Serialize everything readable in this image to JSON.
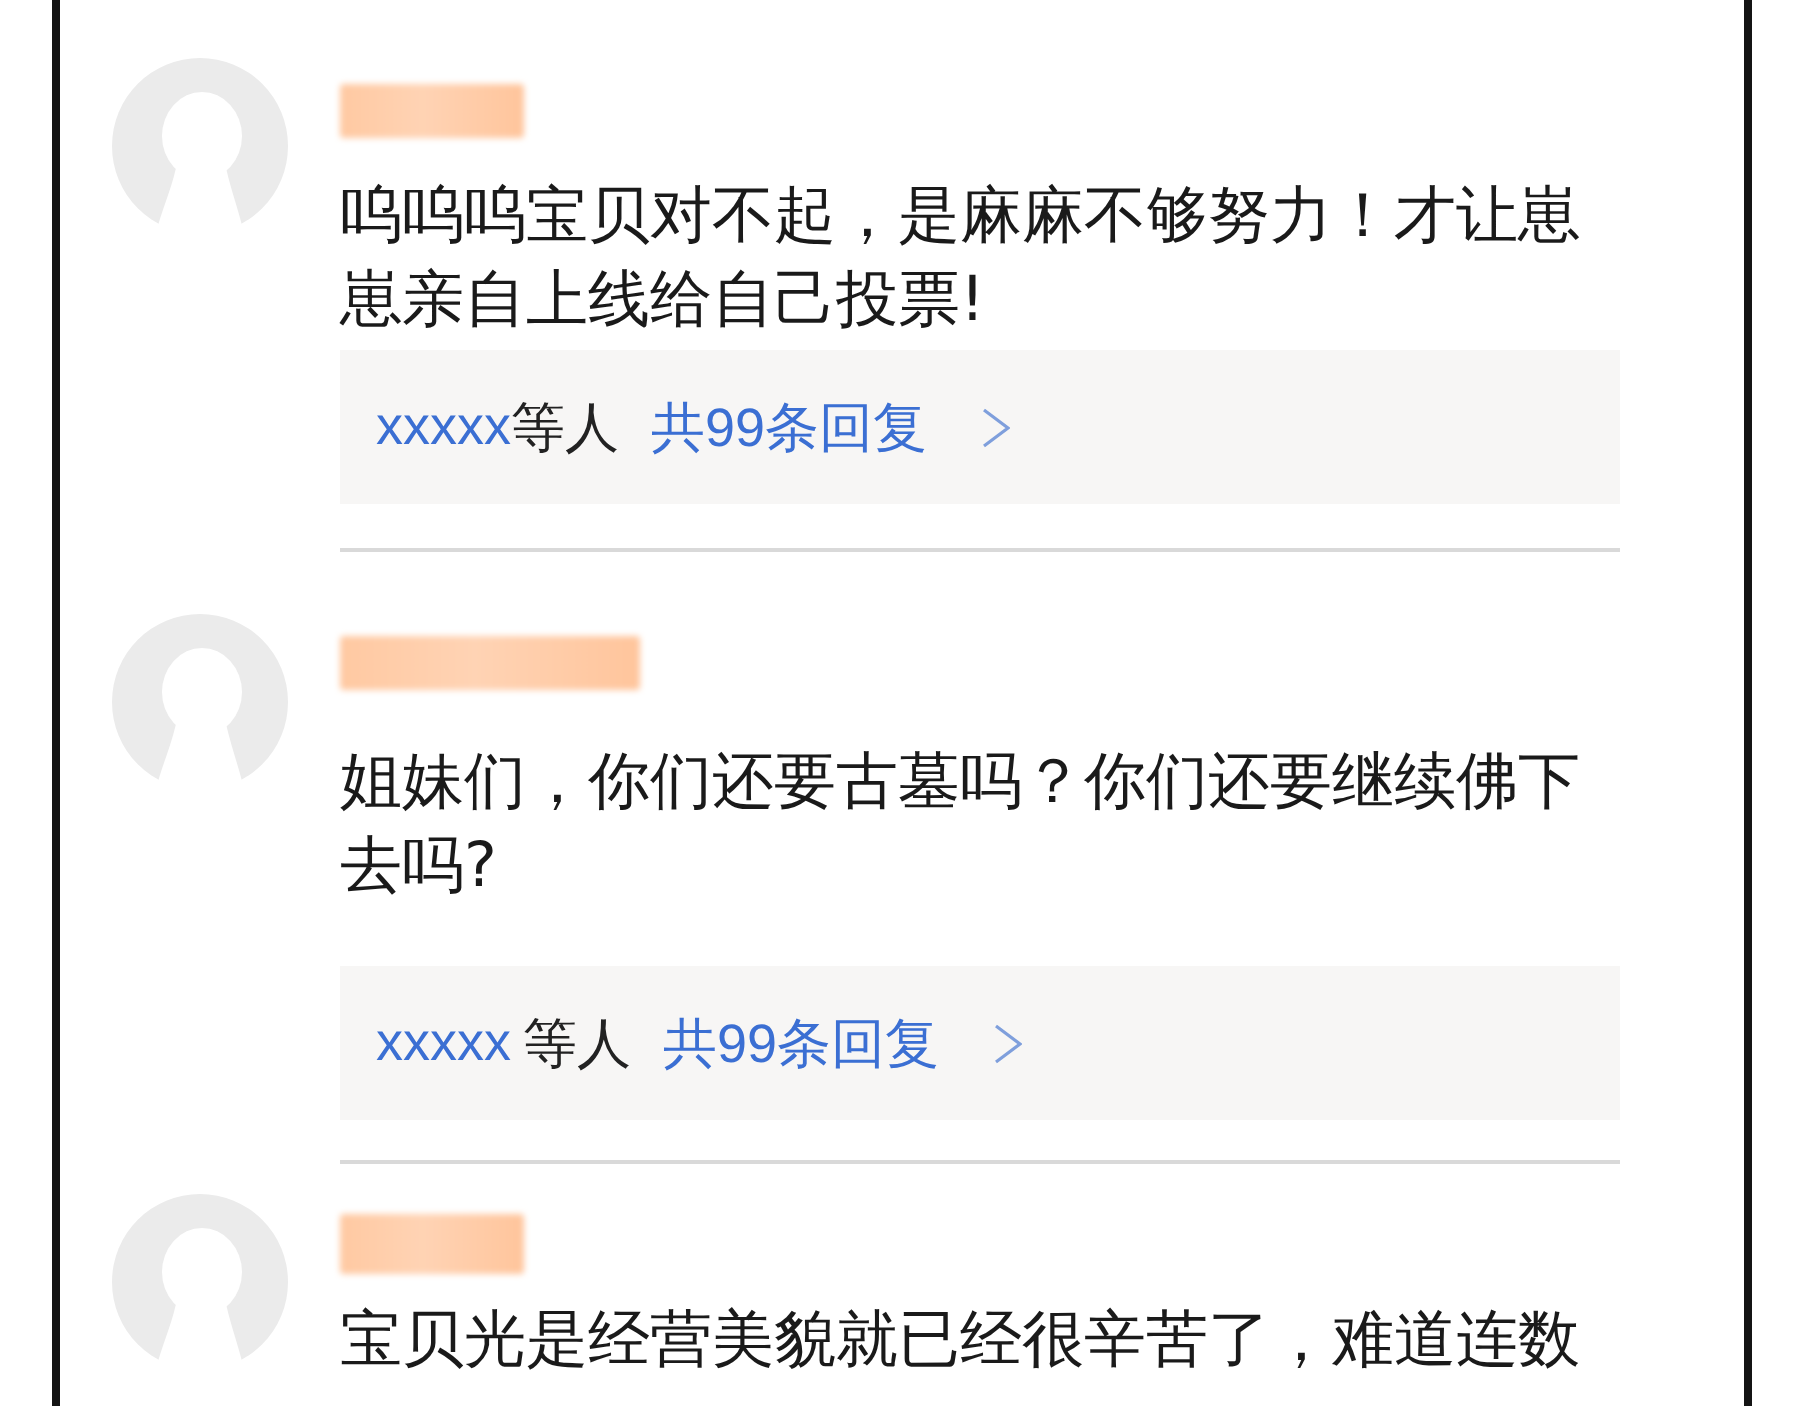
{
  "comments": [
    {
      "text": "呜呜呜宝贝对不起，是麻麻不够努力！才让崽崽亲自上线给自己投票!",
      "replies": {
        "users": "xxxxx",
        "others": "等人",
        "count": "共99条回复"
      }
    },
    {
      "text": "姐妹们，你们还要古墓吗？你们还要继续佛下去吗?",
      "replies": {
        "users": "xxxxx",
        "others": "等人",
        "count": "共99条回复"
      }
    },
    {
      "text": "宝贝光是经营美貌就已经很辛苦了，难道连数"
    }
  ]
}
